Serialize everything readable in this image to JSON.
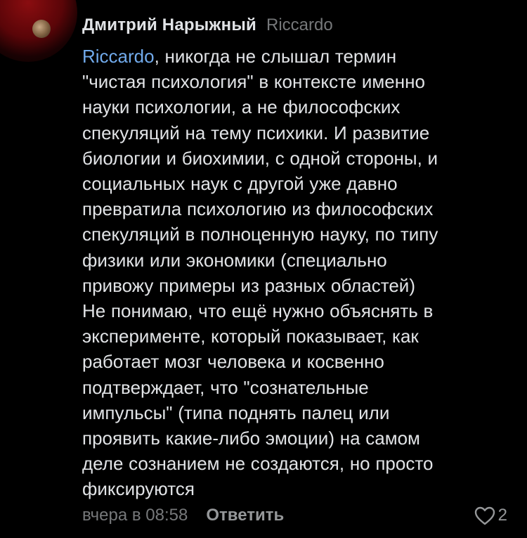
{
  "comment": {
    "author": "Дмитрий Нарыжный",
    "reply_to": "Riccardo",
    "mention": "Riccardo",
    "lines": [
      ", никогда не слышал термин",
      "\"чистая психология\" в контексте именно",
      "науки психологии, а не философских",
      "спекуляций на тему психики. И развитие",
      "биологии и биохимии, с одной стороны, и",
      "социальных наук с другой уже давно",
      "превратила психологию из философских",
      "спекуляций в полноценную науку, по типу",
      "физики или экономики (специально",
      "привожу примеры из разных областей)",
      "Не понимаю, что ещё нужно объяснять в",
      "эксперименте, который показывает, как",
      "работает мозг человека и косвенно",
      "подтверждает, что \"сознательные",
      "импульсы\" (типа поднять палец или",
      "проявить какие-либо эмоции) на самом",
      "деле сознанием не создаются, но просто",
      "фиксируются"
    ]
  },
  "footer": {
    "time": "вчера в 08:58",
    "reply_label": "Ответить",
    "like_count": "2"
  },
  "colors": {
    "background": "#000000",
    "text": "#e1e3e6",
    "muted": "#76787a",
    "mention": "#71aaeb"
  },
  "icons": {
    "like": "heart-outline-icon"
  }
}
